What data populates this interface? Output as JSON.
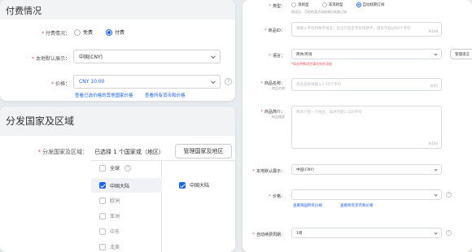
{
  "pay_card": {
    "title": "付费情况",
    "pay_type": {
      "label": "付费情况：",
      "options": [
        "免费",
        "付费"
      ],
      "selected": "付费"
    },
    "currency": {
      "label": "本地默认展示：",
      "value": "中国(CNY)"
    },
    "price": {
      "label": "价格：",
      "value": "CNY 10.00",
      "links": [
        "查看已选价格的其他国家价格",
        "查看所有货币和价格"
      ]
    },
    "help_glyph": "?"
  },
  "dist_card": {
    "title": "分发国家及区域",
    "field_label": "分发国家及区域：",
    "summary": "已选择 1 个国家或（地区）",
    "manage_button": "管理国家及地区",
    "regions": [
      {
        "name": "全球",
        "checked": false
      },
      {
        "name": "中国大陆",
        "checked": true
      },
      {
        "name": "欧洲",
        "checked": false
      },
      {
        "name": "亚洲",
        "checked": false
      },
      {
        "name": "中东",
        "checked": false
      },
      {
        "name": "北美",
        "checked": false
      }
    ],
    "selected_region": {
      "name": "中国大陆",
      "checked": true
    },
    "help_glyph": "?"
  },
  "right_card": {
    "type": {
      "label": "类型：",
      "options": [
        "消耗型",
        "非消耗型",
        "自动续期订阅"
      ],
      "selected": "自动续期订阅",
      "sub": "购买后，可在拍卖活动结束后发放订阅"
    },
    "product_id": {
      "label": "商品ID：",
      "placeholder": "请输入字母和数字组合，首位只能是字母或数字，最多不超过60个字符",
      "counter": "0/148"
    },
    "language": {
      "label": "语言：",
      "value": "简体/英语",
      "hint": "*如无特殊语言请勿另外添加",
      "button": "管理语言"
    },
    "name": {
      "label": "商品名称：",
      "sub": "商品名称",
      "placeholder": "商品名称请输入1-55个字符",
      "counter": "0/55"
    },
    "intro": {
      "label": "商品简介：",
      "sub": "商品描述",
      "placeholder": "简单介绍一下商品，描述内容1-100字符",
      "counter": "0/100"
    },
    "currency": {
      "label": "本地默认展示：",
      "value": "中国(CNY)"
    },
    "price": {
      "label": "价格：",
      "value": "",
      "links": [
        "查看每国所有价格",
        "查看所有货币和价格"
      ]
    },
    "period": {
      "label": "自动续费周期：",
      "value": "1周"
    },
    "help_glyph": "?"
  }
}
